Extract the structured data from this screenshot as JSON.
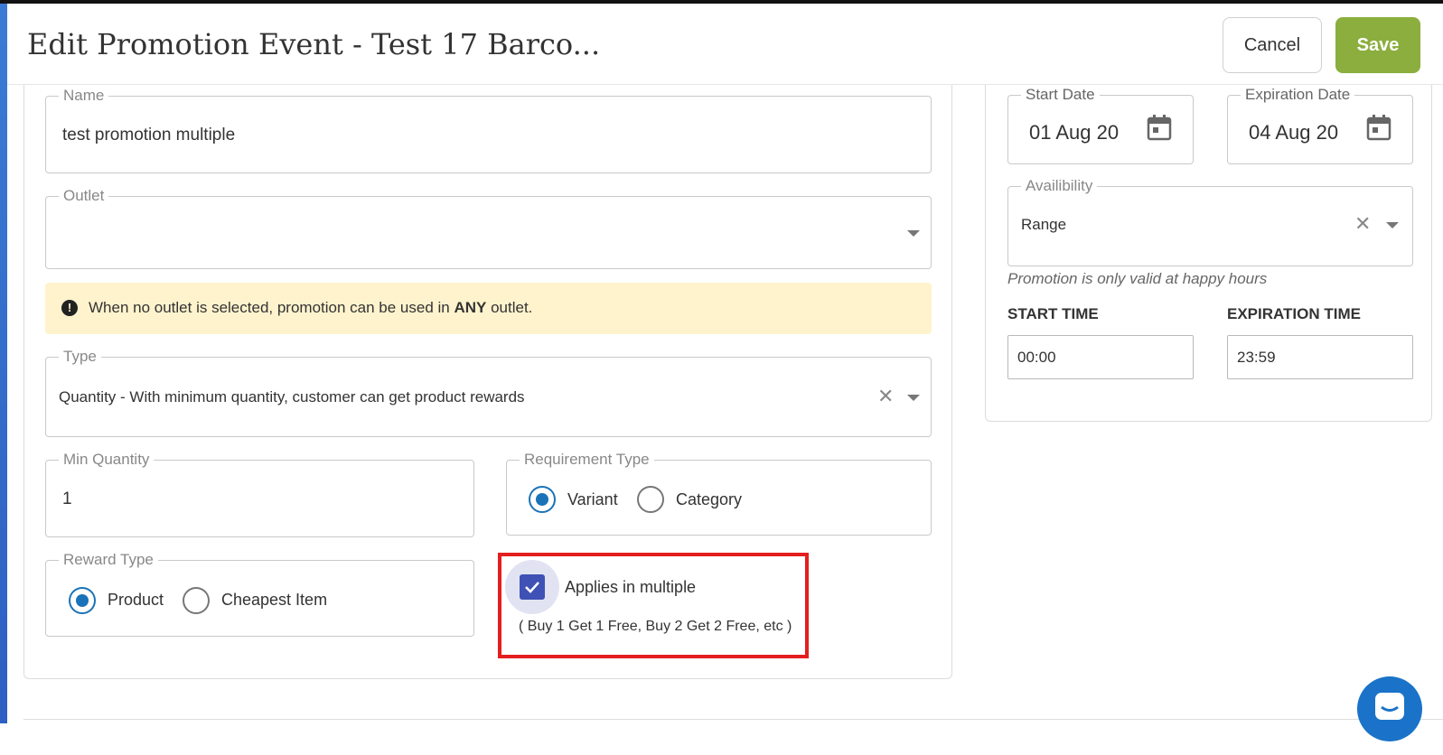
{
  "header": {
    "title": "Edit Promotion Event - Test 17 Barco...",
    "cancel_label": "Cancel",
    "save_label": "Save"
  },
  "form": {
    "name": {
      "label": "Name",
      "value": "test promotion multiple"
    },
    "outlet": {
      "label": "Outlet",
      "value": ""
    },
    "notice": {
      "text_before": "When no outlet is selected, promotion can be used in ",
      "text_bold": "ANY",
      "text_after": " outlet."
    },
    "type": {
      "label": "Type",
      "value": "Quantity - With minimum quantity, customer can get product rewards"
    },
    "min_quantity": {
      "label": "Min Quantity",
      "value": "1"
    },
    "requirement_type": {
      "label": "Requirement Type",
      "options": [
        "Variant",
        "Category"
      ],
      "selected": "Variant"
    },
    "reward_type": {
      "label": "Reward Type",
      "options": [
        "Product",
        "Cheapest Item"
      ],
      "selected": "Product"
    },
    "applies_multiple": {
      "label": "Applies in multiple",
      "hint": "( Buy 1 Get 1 Free, Buy 2 Get 2 Free, etc )",
      "checked": true
    }
  },
  "side": {
    "start_date": {
      "label": "Start Date",
      "value": "01 Aug 20"
    },
    "expiration_date": {
      "label": "Expiration Date",
      "value": "04 Aug 20"
    },
    "availability": {
      "label": "Availibility",
      "value": "Range"
    },
    "availability_note": "Promotion is only valid at happy hours",
    "start_time": {
      "label": "START TIME",
      "value": "00:00"
    },
    "expiration_time": {
      "label": "EXPIRATION TIME",
      "value": "23:59"
    }
  },
  "colors": {
    "save": "#8bae3e",
    "radio_selected": "#1a73b8",
    "checkbox": "#3f51b5",
    "highlight": "#e41e1e",
    "notice_bg": "#fff3cd"
  },
  "icons": [
    "calendar-icon",
    "chevron-down-icon",
    "close-icon",
    "check-icon",
    "info-icon",
    "chat-icon"
  ]
}
